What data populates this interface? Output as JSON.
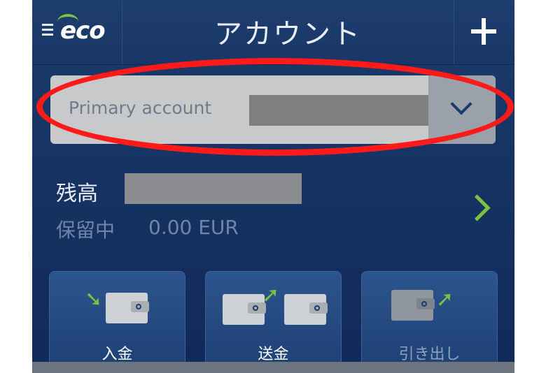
{
  "header": {
    "logo_text": "eco",
    "title": "アカウント",
    "icons": {
      "menu": "hamburger-icon",
      "add": "plus-icon"
    }
  },
  "account_selector": {
    "label": "Primary account",
    "icon": "chevron-down-icon"
  },
  "balance": {
    "label": "残高",
    "pending_label": "保留中",
    "pending_value": "0.00 EUR"
  },
  "actions": [
    {
      "label": "入金",
      "icon": "deposit-wallet-icon"
    },
    {
      "label": "送金",
      "icon": "transfer-wallet-icon"
    },
    {
      "label": "引き出し",
      "icon": "withdraw-wallet-icon"
    }
  ],
  "colors": {
    "accent_green": "#7cc242",
    "highlight_red": "#ff1a1a",
    "navy": "#143160"
  }
}
